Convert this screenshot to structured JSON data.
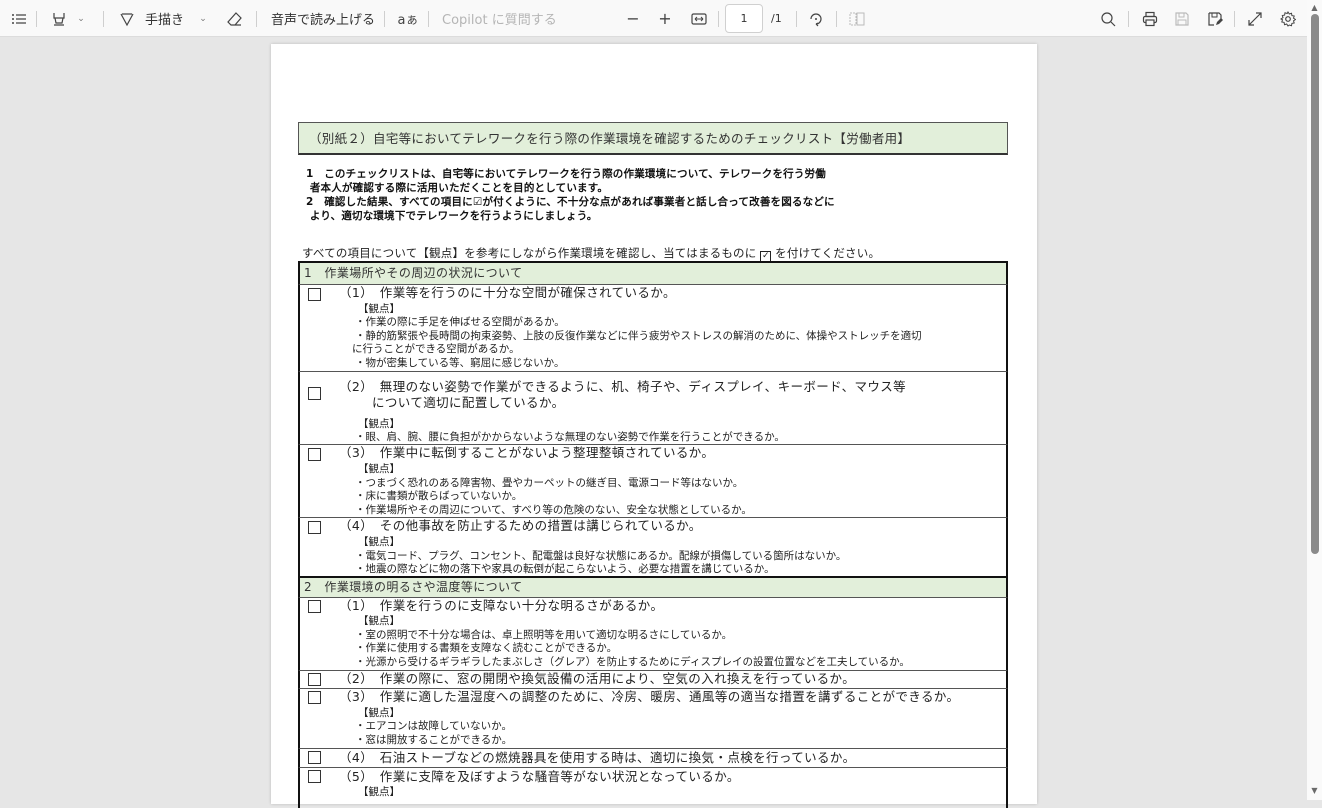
{
  "toolbar": {
    "contents_icon": "table-of-contents-icon",
    "highlight_icon": "highlighter-icon",
    "draw_label": "手描き",
    "erase_icon": "eraser-icon",
    "read_aloud_label": "音声で読み上げる",
    "translate_icon": "translate-icon",
    "copilot_placeholder": "Copilot に質問する",
    "zoom_out": "−",
    "zoom_in": "+",
    "fit_icon": "fit-to-width-icon",
    "page_current": "1",
    "page_total": "/1",
    "rotate_icon": "rotate-icon",
    "page_view_icon": "page-view-icon",
    "search_icon": "search-icon",
    "print_icon": "print-icon",
    "save_icon": "save-icon",
    "save_as_icon": "save-as-icon",
    "fullscreen_icon": "fullscreen-icon",
    "settings_icon": "settings-icon"
  },
  "document": {
    "title": "（別紙２）自宅等においてテレワークを行う際の作業環境を確認するためのチェックリスト【労働者用】",
    "intro_lines": [
      "1　このチェックリストは、自宅等においてテレワークを行う際の作業環境について、テレワークを行う労働",
      " 者本人が確認する際に活用いただくことを目的としています。",
      "2　確認した結果、すべての項目に☑が付くように、不十分な点があれば事業者と話し合って改善を図るなどに",
      " より、適切な環境下でテレワークを行うようにしましょう。"
    ],
    "instruction_pre": "すべての項目について【観点】を参考にしながら作業環境を確認し、当てはまるものに",
    "instruction_check": "✓",
    "instruction_post": " を付けてください。",
    "viewpoint_label": "【観点】",
    "sections": [
      {
        "heading": "1　作業場所やその周辺の状況について",
        "items": [
          {
            "question": "（1）　作業等を行うのに十分な空間が確保されているか。",
            "checked": false,
            "points": [
              "・作業の際に手足を伸ばせる空間があるか。",
              "・静的筋緊張や長時間の拘束姿勢、上肢の反復作業などに伴う疲労やストレスの解消のために、体操やストレッチを適切",
              "に行うことができる空間があるか。",
              "・物が密集している等、窮屈に感じないか。"
            ]
          },
          {
            "question": "（2）　無理のない姿勢で作業ができるように、机、椅子や、ディスプレイ、キーボード、マウス等",
            "question_cont": "について適切に配置しているか。",
            "checked": false,
            "points": [
              "・眼、肩、腕、腰に負担がかからないような無理のない姿勢で作業を行うことができるか。"
            ]
          },
          {
            "question": "（3）　作業中に転倒することがないよう整理整頓されているか。",
            "checked": false,
            "points": [
              "・つまづく恐れのある障害物、畳やカーペットの継ぎ目、電源コード等はないか。",
              "・床に書類が散らばっていないか。",
              "・作業場所やその周辺について、すべり等の危険のない、安全な状態としているか。"
            ]
          },
          {
            "question": "（4）　その他事故を防止するための措置は講じられているか。",
            "checked": false,
            "points": [
              "・電気コード、プラグ、コンセント、配電盤は良好な状態にあるか。配線が損傷している箇所はないか。",
              "・地震の際などに物の落下や家具の転倒が起こらないよう、必要な措置を講じているか。"
            ]
          }
        ]
      },
      {
        "heading": "2　作業環境の明るさや温度等について",
        "items": [
          {
            "question": "（1）　作業を行うのに支障ない十分な明るさがあるか。",
            "checked": false,
            "points": [
              "・室の照明で不十分な場合は、卓上照明等を用いて適切な明るさにしているか。",
              "・作業に使用する書類を支障なく読むことができるか。",
              "・光源から受けるギラギラしたまぶしさ（グレア）を防止するためにディスプレイの設置位置などを工夫しているか。"
            ]
          },
          {
            "question": "（2）　作業の際に、窓の開閉や換気設備の活用により、空気の入れ換えを行っているか。",
            "checked": false,
            "points": []
          },
          {
            "question": "（3）　作業に適した温湿度への調整のために、冷房、暖房、通風等の適当な措置を講ずることができるか。",
            "checked": false,
            "points": [
              "・エアコンは故障していないか。",
              "・窓は開放することができるか。"
            ]
          },
          {
            "question": "（4）　石油ストーブなどの燃焼器具を使用する時は、適切に換気・点検を行っているか。",
            "checked": false,
            "points": []
          },
          {
            "question": "（5）　作業に支障を及ぼすような騒音等がない状況となっているか。",
            "checked": false,
            "points": []
          }
        ]
      }
    ]
  },
  "colors": {
    "section_fill": "#e2efda",
    "toolbar_bg": "#f9f9f9",
    "viewer_bg": "#e6e6e6"
  }
}
